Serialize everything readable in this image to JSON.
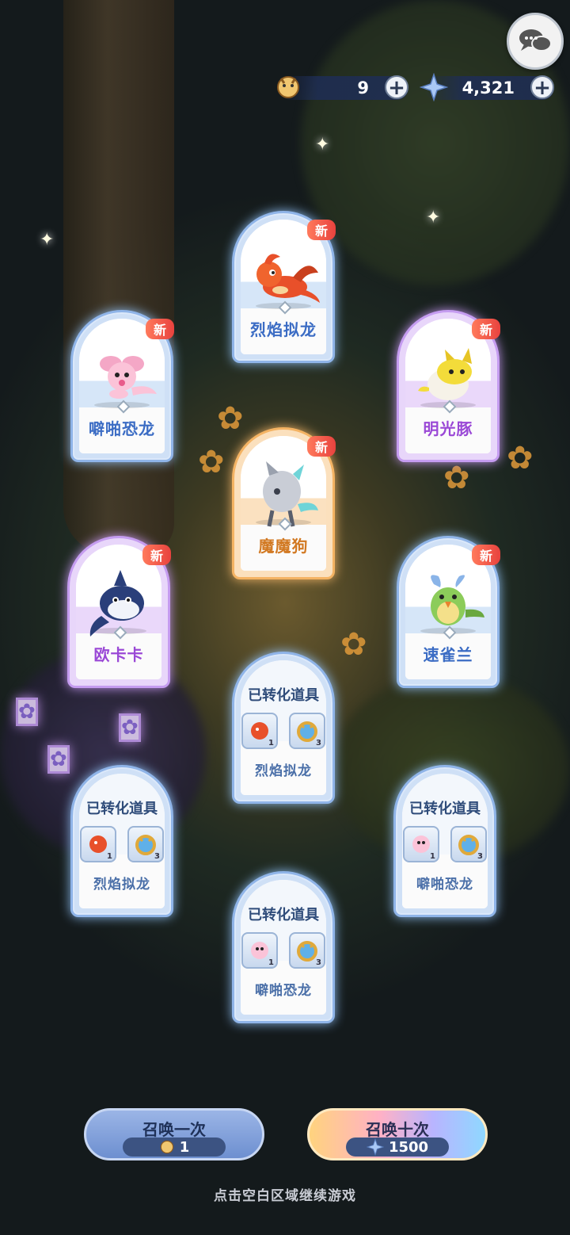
{
  "resources": {
    "tickets": "9",
    "crystals": "4,321"
  },
  "cards": {
    "c1": {
      "name": "烈焰拟龙",
      "badge": "新"
    },
    "c2": {
      "name": "噼啪恐龙",
      "badge": "新"
    },
    "c3": {
      "name": "明光豚",
      "badge": "新"
    },
    "c4": {
      "name": "魔魔狗",
      "badge": "新"
    },
    "c5": {
      "name": "欧卡卡",
      "badge": "新"
    },
    "c6": {
      "name": "速雀兰",
      "badge": "新"
    }
  },
  "converted": {
    "k1": {
      "title": "已转化道具",
      "name": "烈焰拟龙",
      "count_a": "1",
      "count_b": "3"
    },
    "k2": {
      "title": "已转化道具",
      "name": "烈焰拟龙",
      "count_a": "1",
      "count_b": "3"
    },
    "k3": {
      "title": "已转化道具",
      "name": "噼啪恐龙",
      "count_a": "1",
      "count_b": "3"
    },
    "k4": {
      "title": "已转化道具",
      "name": "噼啪恐龙",
      "count_a": "1",
      "count_b": "3"
    }
  },
  "buttons": {
    "summon_one": {
      "label": "召唤一次",
      "cost": "1"
    },
    "summon_ten": {
      "label": "召唤十次",
      "cost": "1500"
    }
  },
  "hint": "点击空白区域继续游戏",
  "colors": {
    "blue": "#8fb4e8",
    "purple": "#c59cf0",
    "orange": "#f4b363"
  }
}
